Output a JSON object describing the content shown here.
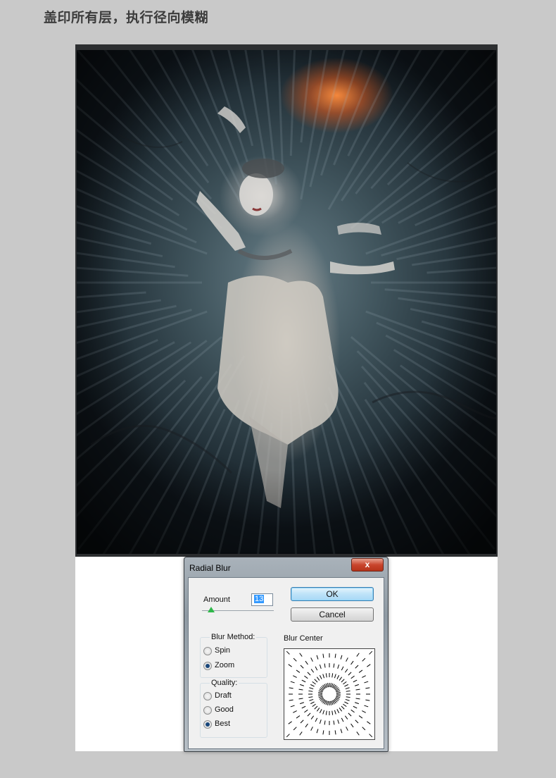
{
  "page": {
    "heading": "盖印所有层，执行径向模糊"
  },
  "dialog": {
    "title": "Radial Blur",
    "close_glyph": "x",
    "amount_label": "Amount",
    "amount_value": "13",
    "ok_label": "OK",
    "cancel_label": "Cancel",
    "blur_method": {
      "label": "Blur Method:",
      "options": [
        "Spin",
        "Zoom"
      ],
      "selected": "Zoom"
    },
    "quality": {
      "label": "Quality:",
      "options": [
        "Draft",
        "Good",
        "Best"
      ],
      "selected": "Best"
    },
    "blur_center_label": "Blur Center"
  },
  "colors": {
    "ok_accent": "#3c7fb1",
    "slider_thumb": "#2fb84a",
    "close_button": "#c9452d"
  }
}
